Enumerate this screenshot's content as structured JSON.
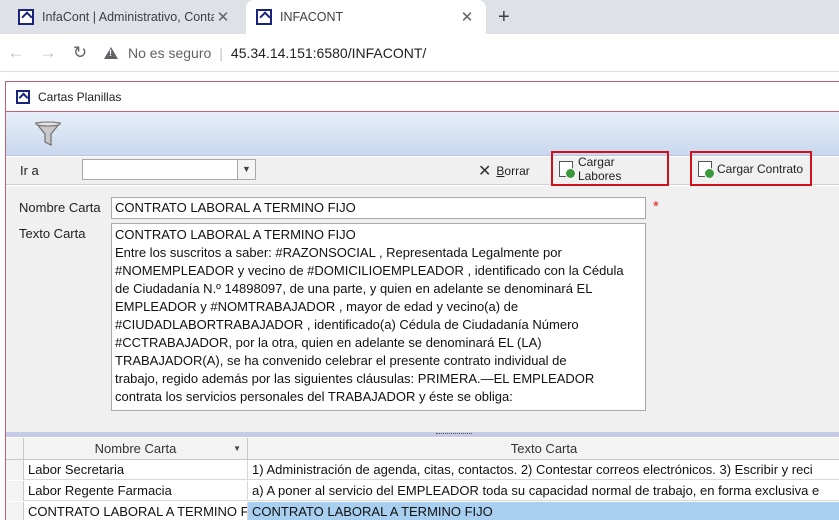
{
  "browser": {
    "tabs": [
      {
        "title": "InfaCont | Administrativo, Contab"
      },
      {
        "title": "INFACONT"
      }
    ],
    "security_label": "No es seguro",
    "url": "45.34.14.151:6580/INFACONT/"
  },
  "app": {
    "window_title": "Cartas Planillas",
    "toolbar": {
      "goto_label": "Ir a",
      "goto_value": "",
      "borrar_label": "orrar",
      "borrar_accel": "B",
      "cargar_labores_label": "Cargar Labores",
      "cargar_contrato_label": "Cargar Contrato"
    },
    "form": {
      "nombre_label": "Nombre Carta",
      "nombre_value": "CONTRATO LABORAL A TERMINO FIJO",
      "required_mark": "*",
      "texto_label": "Texto Carta",
      "texto_lines": [
        "CONTRATO LABORAL A TERMINO FIJO",
        "Entre los suscritos a saber: #RAZONSOCIAL , Representada Legalmente por",
        "#NOMEMPLEADOR y vecino de #DOMICILIOEMPLEADOR , identificado con la Cédula",
        "de Ciudadanía N.º 14898097, de una parte, y quien en adelante se denominará EL",
        "EMPLEADOR y #NOMTRABAJADOR , mayor de edad y vecino(a) de",
        "#CIUDADLABORTRABAJADOR , identificado(a) Cédula de Ciudadanía Número",
        "#CCTRABAJADOR, por la otra, quien en adelante se denominará EL (LA)",
        "TRABAJADOR(A), se ha convenido celebrar el presente contrato individual de",
        "trabajo, regido además por las siguientes cláusulas: PRIMERA.—EL EMPLEADOR",
        "contrata los servicios personales del TRABAJADOR y éste se obliga:"
      ]
    },
    "grid": {
      "columns": [
        "Nombre Carta",
        "Texto Carta"
      ],
      "rows": [
        {
          "nombre": "Labor Secretaria",
          "texto": "1) Administración de agenda, citas, contactos. 2) Contestar correos electrónicos. 3) Escribir y reci"
        },
        {
          "nombre": "Labor Regente Farmacia",
          "texto": "a) A poner al servicio del EMPLEADOR toda su capacidad normal de trabajo, en forma exclusiva e"
        },
        {
          "nombre": "CONTRATO LABORAL A TERMINO FI",
          "texto": "CONTRATO LABORAL A TERMINO FIJO"
        }
      ]
    }
  },
  "colors": {
    "highlight_border": "#d0101a",
    "selection": "#a8cff0",
    "ribbon": "#c9d8ee",
    "favicon": "#1a237e"
  },
  "icons": [
    "favicon-icon",
    "close-icon",
    "new-tab-icon",
    "back-icon",
    "forward-icon",
    "reload-icon",
    "warning-icon",
    "filter-icon",
    "dropdown-arrow-icon",
    "delete-x-icon",
    "document-load-icon",
    "sort-arrow-icon"
  ]
}
